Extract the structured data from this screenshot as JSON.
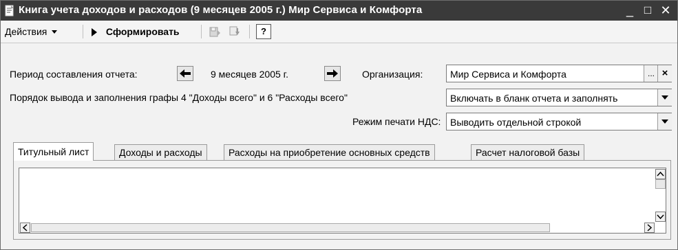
{
  "window": {
    "title": "Книга учета доходов и расходов (9 месяцев 2005 г.) Мир Сервиса и Комфорта",
    "minimize": "_",
    "maximize": "□",
    "close": "✕",
    "icon": "document-icon"
  },
  "toolbar": {
    "actions_label": "Действия",
    "generate_label": "Сформировать",
    "help_label": "?",
    "icons": [
      "dropdown-arrow-icon",
      "play-icon",
      "save-disk-icon",
      "copy-arrow-icon",
      "help-icon"
    ]
  },
  "form": {
    "period_label": "Период составления отчета:",
    "period_value": "9 месяцев 2005 г.",
    "org_label": "Организация:",
    "org_value": "Мир Сервиса и Комфорта",
    "order_label": "Порядок вывода и заполнения графы 4 \"Доходы всего\" и 6 \"Расходы всего\"",
    "order_value": "Включать в бланк отчета и заполнять",
    "vat_label": "Режим печати НДС:",
    "vat_value": "Выводить отдельной строкой",
    "select_button": "...",
    "clear_button": "×"
  },
  "tabs": [
    {
      "label": "Титульный лист",
      "active": true
    },
    {
      "label": "Доходы и расходы",
      "active": false
    },
    {
      "label": "Расходы на приобретение основных средств",
      "active": false
    },
    {
      "label": "Расчет налоговой базы",
      "active": false
    }
  ],
  "colors": {
    "titlebar": "#3a3a3a",
    "window_bg": "#f2f2f2",
    "field_bg": "#ffffff"
  }
}
